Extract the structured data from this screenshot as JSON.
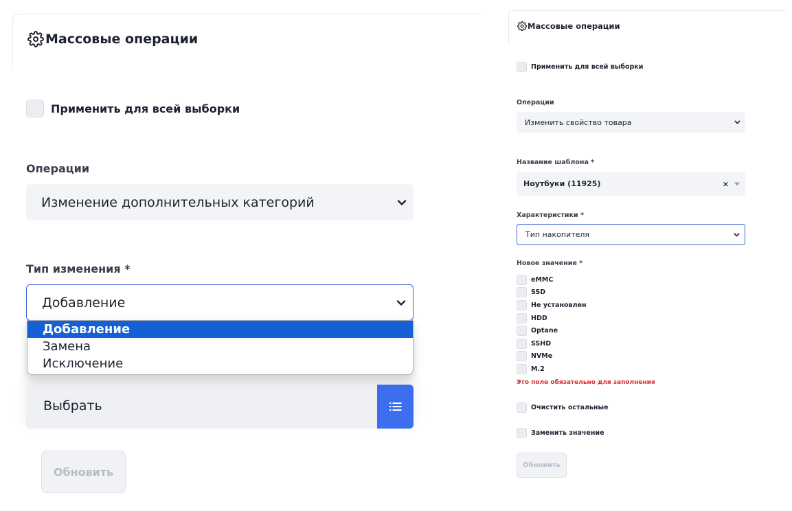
{
  "left": {
    "title": "Массовые операции",
    "apply_all_label": "Применить для всей выборки",
    "operations_label": "Операции",
    "operations_value": "Изменение дополнительных категорий",
    "change_type_label": "Тип изменения *",
    "change_type_value": "Добавление",
    "change_type_options": [
      "Добавление",
      "Замена",
      "Исключение"
    ],
    "pick_label": "Выбрать",
    "update_label": "Обновить"
  },
  "right": {
    "title": "Массовые операции",
    "apply_all_label": "Применить для всей выборки",
    "operations_label": "Операции",
    "operations_value": "Изменить свойство товара",
    "template_label": "Название шаблона *",
    "template_value": "Ноутбуки (11925)",
    "template_clear": "×",
    "characteristics_label": "Характеристики *",
    "characteristics_value": "Тип накопителя",
    "new_value_label": "Новое значение *",
    "values": [
      "eMMC",
      "SSD",
      "Не установлен",
      "HDD",
      "Optane",
      "SSHD",
      "NVMe",
      "M.2"
    ],
    "error_text": "Это поле обязательно для заполнения",
    "clear_others_label": "Очистить остальные",
    "replace_value_label": "Заменить значение",
    "update_label": "Обновить"
  },
  "colors": {
    "accent_blue": "#3d6ef0",
    "selected_option": "#1560d4",
    "error_red": "#d42b2b",
    "field_bg": "#f2f4f7"
  },
  "icons": [
    "gear-icon",
    "chevron-down-icon",
    "list-icon",
    "clear-icon",
    "caret-down-icon"
  ]
}
